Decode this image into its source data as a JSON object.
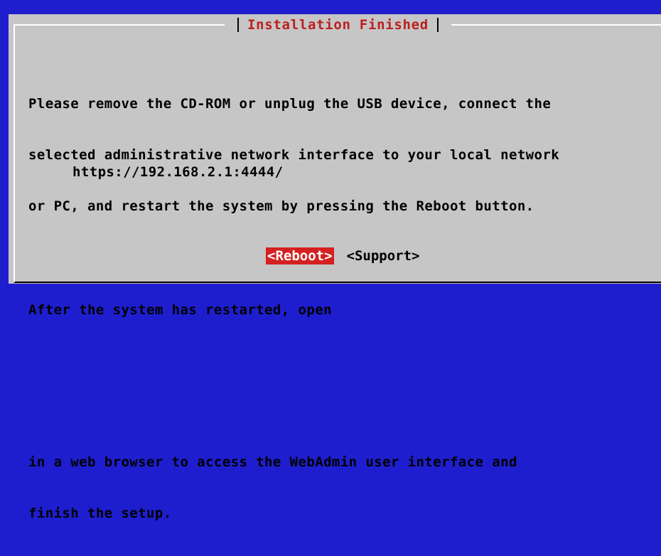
{
  "dialog": {
    "title": "Installation Finished",
    "paragraph1": [
      "Please remove the CD-ROM or unplug the USB device, connect the",
      "selected administrative network interface to your local network",
      "or PC, and restart the system by pressing the Reboot button."
    ],
    "paragraph2": "After the system has restarted, open",
    "url": "https://192.168.2.1:4444/",
    "paragraph3": [
      "in a web browser to access the WebAdmin user interface and",
      "finish the setup."
    ]
  },
  "buttons": {
    "reboot_label": "<Reboot>",
    "support_label": "<Support>"
  },
  "colors": {
    "background": "#1e1ecf",
    "dialog": "#c6c6c6",
    "title": "#bd1f1f",
    "focused_button": "#d42020"
  }
}
